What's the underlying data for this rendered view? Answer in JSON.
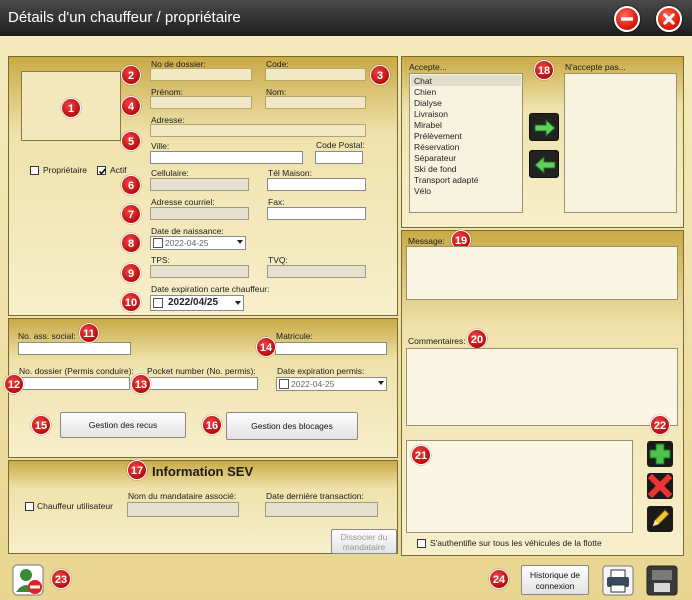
{
  "window": {
    "title": "Détails d'un chauffeur / propriétaire"
  },
  "driver": {
    "no_dossier_label": "No de dossier:",
    "code_label": "Code:",
    "prenom_label": "Prénom:",
    "nom_label": "Nom:",
    "adresse_label": "Adresse:",
    "ville_label": "Ville:",
    "code_postal_label": "Code Postal:",
    "proprietaire_label": "Propriétaire",
    "proprietaire_checked": false,
    "actif_label": "Actif",
    "actif_checked": true,
    "cellulaire_label": "Cellulaire:",
    "tel_maison_label": "Tél Maison:",
    "courriel_label": "Adresse courriel:",
    "fax_label": "Fax:",
    "naissance_label": "Date de naissance:",
    "naissance_value": "2022-04-25",
    "tps_label": "TPS:",
    "tvq_label": "TVQ:",
    "expiration_carte_label": "Date expiration carte chauffeur:",
    "expiration_carte_value": "2022/04/25"
  },
  "permit": {
    "ass_sociale_label": "No. ass. social:",
    "matricule_label": "Matricule:",
    "dossier_permis_label": "No. dossier (Permis conduire):",
    "pocket_label": "Pocket number (No. permis):",
    "expiration_permis_label": "Date expiration permis:",
    "expiration_permis_value": "2022-04-25",
    "gestion_recus": "Gestion des recus",
    "gestion_blocages": "Gestion des blocages"
  },
  "sev": {
    "heading": "Information SEV",
    "chauffeur_utilisateur_label": "Chauffeur utilisateur",
    "mandataire_label": "Nom du mandataire associé:",
    "derniere_transaction_label": "Date dernière transaction:",
    "dissocier_line1": "Dissocier du",
    "dissocier_line2": "mandataire"
  },
  "accepts": {
    "accepte_label": "Accepte...",
    "naccepte_label": "N'accepte pas...",
    "items": [
      "Chat",
      "Chien",
      "Dialyse",
      "Livraison",
      "Mirabel",
      "Prélèvement",
      "Réservation",
      "Séparateur",
      "Ski de fond",
      "Transport adapté",
      "Vélo"
    ]
  },
  "notes": {
    "message_label": "Message:",
    "commentaires_label": "Commentaires:",
    "sauthentifie_label": "S'authentifie sur tous les véhicules de la flotte"
  },
  "footer": {
    "historique_line1": "Historique de",
    "historique_line2": "connexion"
  },
  "callouts": [
    "1",
    "2",
    "3",
    "4",
    "5",
    "6",
    "7",
    "8",
    "9",
    "10",
    "11",
    "12",
    "13",
    "14",
    "15",
    "16",
    "17",
    "18",
    "19",
    "20",
    "21",
    "22",
    "23",
    "24"
  ],
  "colors": {
    "title_bar": "#2b2b2b",
    "panel_gold": "#c9aa45",
    "panel_cream": "#f7efcb",
    "callout_red": "#c01010",
    "accent_green": "#3aa53a"
  }
}
